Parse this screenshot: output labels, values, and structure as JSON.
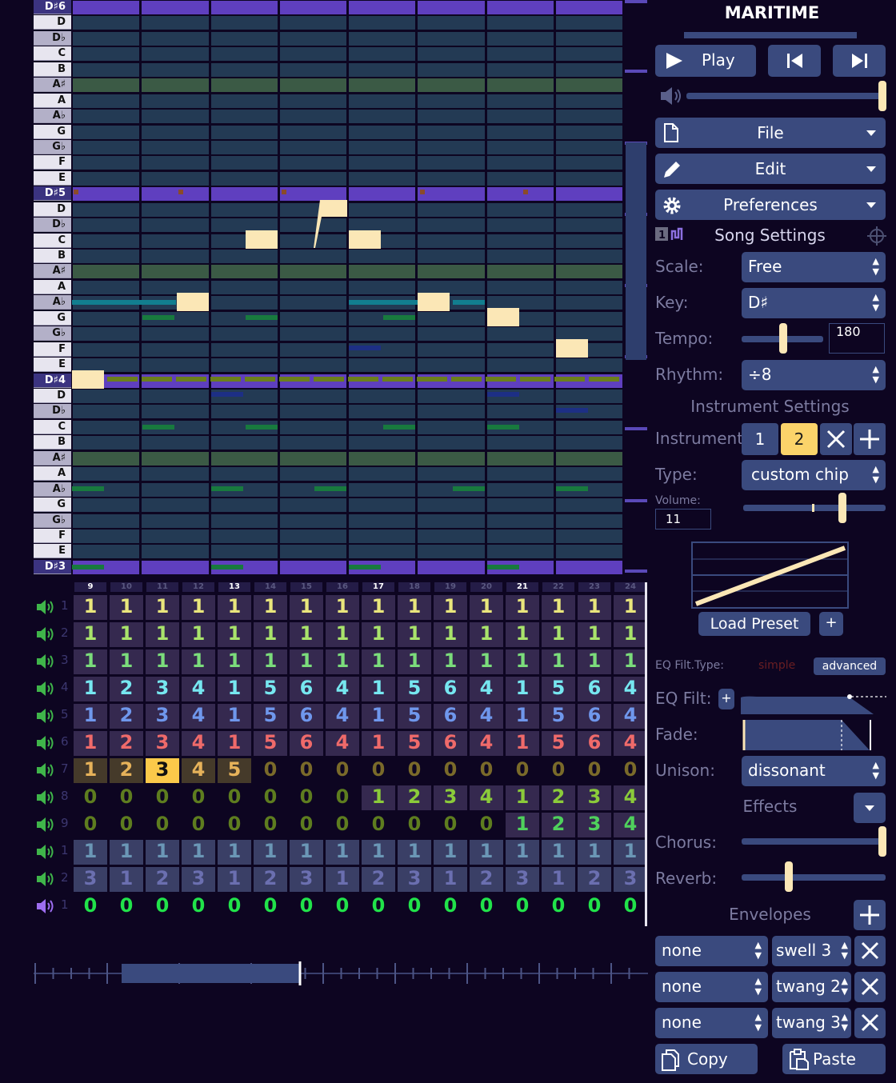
{
  "app_title": "MARITIME",
  "piano_keys": [
    "D♯6",
    "D",
    "D♭",
    "C",
    "B",
    "A♯",
    "A",
    "A♭",
    "G",
    "G♭",
    "F",
    "E",
    "D♯5",
    "D",
    "D♭",
    "C",
    "B",
    "A♯",
    "A",
    "A♭",
    "G",
    "G♭",
    "F",
    "E",
    "D♯4",
    "D",
    "D♭",
    "C",
    "B",
    "A♯",
    "A",
    "A♭",
    "G",
    "G♭",
    "F",
    "E",
    "D♯3"
  ],
  "column_numbers": [
    "9",
    "10",
    "11",
    "12",
    "13",
    "14",
    "15",
    "16",
    "17",
    "18",
    "19",
    "20",
    "21",
    "22",
    "23",
    "24"
  ],
  "highlighted_columns": [
    "9",
    "13",
    "17",
    "21"
  ],
  "channels": [
    {
      "num": "1",
      "values": [
        "1",
        "1",
        "1",
        "1",
        "1",
        "1",
        "1",
        "1",
        "1",
        "1",
        "1",
        "1",
        "1",
        "1",
        "1",
        "1"
      ]
    },
    {
      "num": "2",
      "values": [
        "1",
        "1",
        "1",
        "1",
        "1",
        "1",
        "1",
        "1",
        "1",
        "1",
        "1",
        "1",
        "1",
        "1",
        "1",
        "1"
      ]
    },
    {
      "num": "3",
      "values": [
        "1",
        "1",
        "1",
        "1",
        "1",
        "1",
        "1",
        "1",
        "1",
        "1",
        "1",
        "1",
        "1",
        "1",
        "1",
        "1"
      ]
    },
    {
      "num": "4",
      "values": [
        "1",
        "2",
        "3",
        "4",
        "1",
        "5",
        "6",
        "4",
        "1",
        "5",
        "6",
        "4",
        "1",
        "5",
        "6",
        "4"
      ]
    },
    {
      "num": "5",
      "values": [
        "1",
        "2",
        "3",
        "4",
        "1",
        "5",
        "6",
        "4",
        "1",
        "5",
        "6",
        "4",
        "1",
        "5",
        "6",
        "4"
      ]
    },
    {
      "num": "6",
      "values": [
        "1",
        "2",
        "3",
        "4",
        "1",
        "5",
        "6",
        "4",
        "1",
        "5",
        "6",
        "4",
        "1",
        "5",
        "6",
        "4"
      ]
    },
    {
      "num": "7",
      "values": [
        "1",
        "2",
        "3",
        "4",
        "5",
        "0",
        "0",
        "0",
        "0",
        "0",
        "0",
        "0",
        "0",
        "0",
        "0",
        "0"
      ]
    },
    {
      "num": "8",
      "values": [
        "0",
        "0",
        "0",
        "0",
        "0",
        "0",
        "0",
        "0",
        "1",
        "2",
        "3",
        "4",
        "1",
        "2",
        "3",
        "4"
      ]
    },
    {
      "num": "9",
      "values": [
        "0",
        "0",
        "0",
        "0",
        "0",
        "0",
        "0",
        "0",
        "0",
        "0",
        "0",
        "0",
        "1",
        "2",
        "3",
        "4"
      ]
    },
    {
      "num": "1",
      "values": [
        "1",
        "1",
        "1",
        "1",
        "1",
        "1",
        "1",
        "1",
        "1",
        "1",
        "1",
        "1",
        "1",
        "1",
        "1",
        "1"
      ]
    },
    {
      "num": "2",
      "values": [
        "3",
        "1",
        "2",
        "3",
        "1",
        "2",
        "3",
        "1",
        "2",
        "3",
        "1",
        "2",
        "3",
        "1",
        "2",
        "3"
      ]
    },
    {
      "num": "1",
      "values": [
        "0",
        "0",
        "0",
        "0",
        "0",
        "0",
        "0",
        "0",
        "0",
        "0",
        "0",
        "0",
        "0",
        "0",
        "0",
        "0"
      ]
    }
  ],
  "channel_colors": [
    "#e9e67c",
    "#a9e36b",
    "#7bdc7b",
    "#76e7f0",
    "#6f97ec",
    "#ef6a6a",
    "#e6b25a",
    "#8bcb3a",
    "#4fd15c",
    "#6b97b6",
    "#6b6fb0",
    "#21e34a"
  ],
  "selected_cell": {
    "channel": 7,
    "column": "11"
  },
  "transport": {
    "play_label": "Play"
  },
  "menus": {
    "file": "File",
    "edit": "Edit",
    "preferences": "Preferences"
  },
  "song_settings": {
    "heading": "Song Settings",
    "scale_label": "Scale:",
    "scale_value": "Free",
    "key_label": "Key:",
    "key_value": "D♯",
    "tempo_label": "Tempo:",
    "tempo_value": "180",
    "rhythm_label": "Rhythm:",
    "rhythm_value": "÷8"
  },
  "instrument_settings": {
    "heading": "Instrument Settings",
    "instrument_label": "Instrument:",
    "instrument_tabs": [
      "1",
      "2"
    ],
    "active_instrument": "2",
    "type_label": "Type:",
    "type_value": "custom chip",
    "volume_label": "Volume:",
    "volume_value": "11",
    "load_preset": "Load Preset",
    "eq_type_label": "EQ Filt.Type:",
    "eq_simple": "simple",
    "eq_advanced": "advanced",
    "eq_filt_label": "EQ Filt:",
    "fade_label": "Fade:",
    "unison_label": "Unison:",
    "unison_value": "dissonant",
    "effects_heading": "Effects",
    "chorus_label": "Chorus:",
    "reverb_label": "Reverb:",
    "envelopes_heading": "Envelopes",
    "envelopes": [
      {
        "target": "none",
        "envelope": "swell 3"
      },
      {
        "target": "none",
        "envelope": "twang 2"
      },
      {
        "target": "none",
        "envelope": "twang 3"
      }
    ],
    "copy_label": "Copy",
    "paste_label": "Paste"
  },
  "levels": {
    "volume_slider": 0.97,
    "tempo_slider": 0.45,
    "instrument_volume": 0.7,
    "chorus": 1.0,
    "reverb": 0.33
  }
}
